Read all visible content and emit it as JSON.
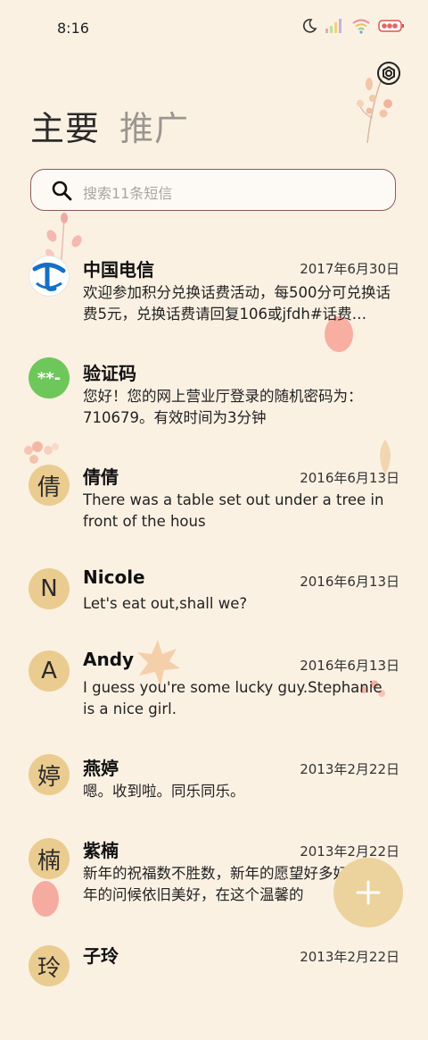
{
  "status_bar": {
    "time": "8:16"
  },
  "tabs": [
    {
      "label": "主要"
    },
    {
      "label": "推广"
    }
  ],
  "search": {
    "placeholder": "搜索11条短信"
  },
  "conversations": [
    {
      "name": "中国电信",
      "date": "2017年6月30日",
      "snippet": "欢迎参加积分兑换话费活动，每500分可兑换话费5元，兑换话费请回复106或jfdh#话费…",
      "avatar": ""
    },
    {
      "name": "验证码",
      "date": "",
      "snippet": "您好！您的网上营业厅登录的随机密码为：710679。有效时间为3分钟",
      "avatar": "**-"
    },
    {
      "name": "倩倩",
      "date": "2016年6月13日",
      "snippet": "There was a table set out under a tree in front of the hous",
      "avatar": "倩"
    },
    {
      "name": "Nicole",
      "date": "2016年6月13日",
      "snippet": "Let's eat out,shall we?",
      "avatar": "N"
    },
    {
      "name": "Andy",
      "date": "2016年6月13日",
      "snippet": "I guess you're some lucky guy.Stephanie is a nice girl.",
      "avatar": "A"
    },
    {
      "name": "燕婷",
      "date": "2013年2月22日",
      "snippet": "嗯。收到啦。同乐同乐。",
      "avatar": "婷"
    },
    {
      "name": "紫楠",
      "date": "2013年2月22日",
      "snippet": "新年的祝福数不胜数，新年的愿望好多好多，新年的问候依旧美好，在这个温馨的",
      "avatar": "楠"
    },
    {
      "name": "子玲",
      "date": "2013年2月22日",
      "snippet": "",
      "avatar": "玲"
    }
  ],
  "colors": {
    "background": "#fbf1e3",
    "avatar": "#ebcc90",
    "fab": "#ecd29d",
    "search_border": "#8b5a5a"
  },
  "icons": {
    "settings": "gear-icon",
    "search": "search-icon",
    "compose": "plus-icon"
  }
}
